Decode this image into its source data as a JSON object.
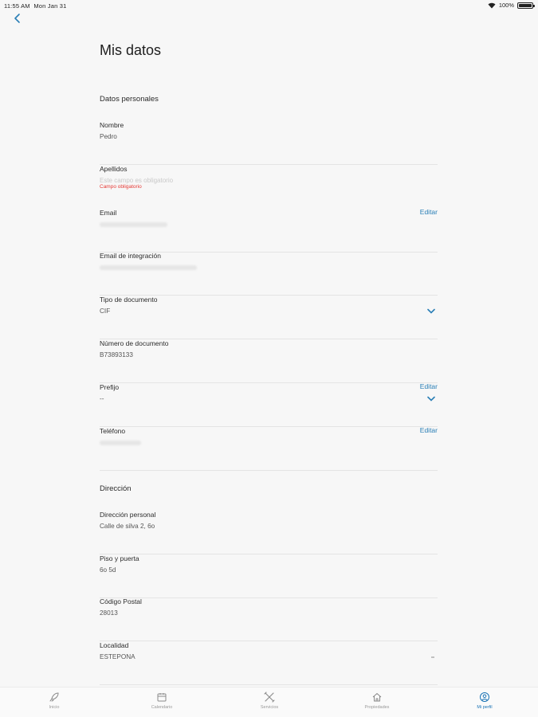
{
  "status": {
    "time": "11:55 AM",
    "date": "Mon Jan 31",
    "battery": "100%"
  },
  "title": "Mis datos",
  "sections": {
    "personal": "Datos personales",
    "address": "Dirección"
  },
  "fields": {
    "nombre": {
      "label": "Nombre",
      "value": "Pedro"
    },
    "apellidos": {
      "label": "Apellidos",
      "placeholder": "Este campo es obligatorio",
      "error": "Campo obligatorio"
    },
    "email": {
      "label": "Email",
      "edit": "Editar"
    },
    "email_integracion": {
      "label": "Email de integración"
    },
    "tipo_documento": {
      "label": "Tipo de documento",
      "value": "CIF"
    },
    "numero_documento": {
      "label": "Número de documento",
      "value": "B73893133"
    },
    "prefijo": {
      "label": "Prefijo",
      "value": "--",
      "edit": "Editar"
    },
    "telefono": {
      "label": "Teléfono",
      "edit": "Editar"
    },
    "direccion_personal": {
      "label": "Dirección personal",
      "value": "Calle de silva 2, 6o"
    },
    "piso_puerta": {
      "label": "Piso y puerta",
      "value": "6o 5d"
    },
    "codigo_postal": {
      "label": "Código Postal",
      "value": "28013"
    },
    "localidad": {
      "label": "Localidad",
      "value": "ESTEPONA"
    }
  },
  "tabs": [
    {
      "label": "Inicio",
      "icon": "rocket-icon"
    },
    {
      "label": "Calendario",
      "icon": "calendar-icon"
    },
    {
      "label": "Servicios",
      "icon": "tools-icon"
    },
    {
      "label": "Propiedades",
      "icon": "home-icon"
    },
    {
      "label": "Mi perfil",
      "icon": "profile-icon",
      "active": true
    }
  ],
  "colors": {
    "accent": "#2a7fb6",
    "error": "#e53935",
    "background": "#f7f7f7"
  }
}
